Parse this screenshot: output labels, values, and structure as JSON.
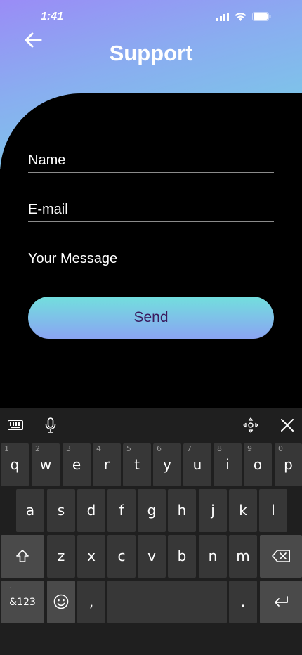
{
  "status": {
    "time": "1:41"
  },
  "header": {
    "title": "Support"
  },
  "form": {
    "name_label": "Name",
    "email_label": "E-mail",
    "message_label": "Your Message",
    "send_label": "Send"
  },
  "keyboard": {
    "row1": [
      {
        "ch": "q",
        "num": "1"
      },
      {
        "ch": "w",
        "num": "2"
      },
      {
        "ch": "e",
        "num": "3"
      },
      {
        "ch": "r",
        "num": "4"
      },
      {
        "ch": "t",
        "num": "5"
      },
      {
        "ch": "y",
        "num": "6"
      },
      {
        "ch": "u",
        "num": "7"
      },
      {
        "ch": "i",
        "num": "8"
      },
      {
        "ch": "o",
        "num": "9"
      },
      {
        "ch": "p",
        "num": "0"
      }
    ],
    "row2": [
      "a",
      "s",
      "d",
      "f",
      "g",
      "h",
      "j",
      "k",
      "l"
    ],
    "row3": [
      "z",
      "x",
      "c",
      "v",
      "b",
      "n",
      "m"
    ],
    "symbols_label": "&123",
    "symbols_hint": "...",
    "comma": ",",
    "period": "."
  },
  "icons": {
    "back": "arrow-left-icon",
    "signal": "signal-icon",
    "wifi": "wifi-icon",
    "battery": "battery-icon",
    "keyboard": "keyboard-icon",
    "mic": "microphone-icon",
    "move": "move-cursor-icon",
    "close": "close-icon",
    "shift": "shift-icon",
    "backspace": "backspace-icon",
    "emoji": "emoji-icon",
    "enter": "enter-icon"
  },
  "colors": {
    "gradient_top": "#9a8cf6",
    "gradient_bottom": "#74d6e3",
    "button_text": "#3a1a5e"
  }
}
